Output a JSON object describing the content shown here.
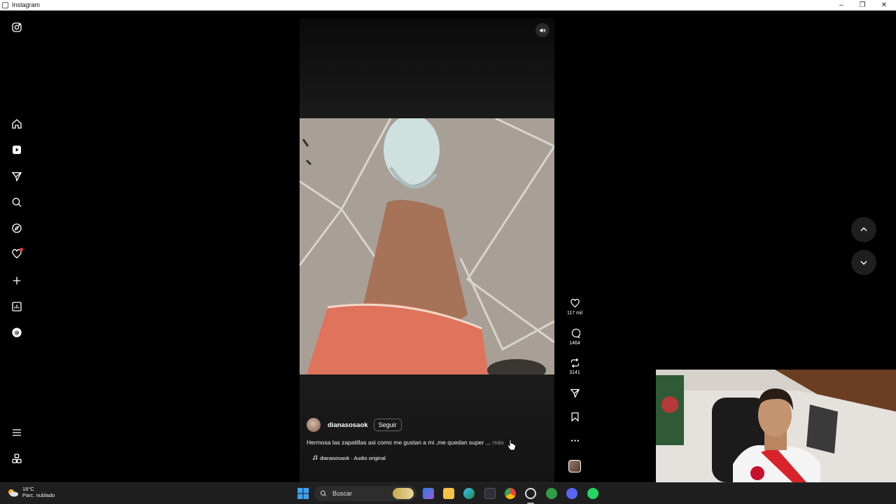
{
  "window": {
    "title": "Instagram"
  },
  "nav": {
    "items": [
      {
        "icon": "instagram-logo-icon"
      },
      {
        "icon": "home-icon"
      },
      {
        "icon": "reels-icon"
      },
      {
        "icon": "messages-icon"
      },
      {
        "icon": "search-icon"
      },
      {
        "icon": "explore-icon"
      },
      {
        "icon": "notifications-icon",
        "badge": true
      },
      {
        "icon": "create-icon"
      },
      {
        "icon": "dashboard-icon"
      },
      {
        "icon": "threads-icon"
      },
      {
        "icon": "more-menu-icon"
      },
      {
        "icon": "also-from-meta-icon"
      }
    ]
  },
  "reel": {
    "username": "dianasosaok",
    "follow_label": "Seguir",
    "caption": "Hermosa las zapatillas asi como me gustan a mi ,me quedan super ...",
    "caption_more": "más",
    "audio": "dianasosaok · Audio original"
  },
  "actions": {
    "likes": "117 mil",
    "comments": "1464",
    "reposts": "3141"
  },
  "taskbar": {
    "weather_temp": "18°C",
    "weather_desc": "Parc. nublado",
    "search_placeholder": "Buscar"
  },
  "colors": {
    "background": "#000000",
    "accent_notification": "#ff3040",
    "taskbar": "#1f1f1f"
  }
}
